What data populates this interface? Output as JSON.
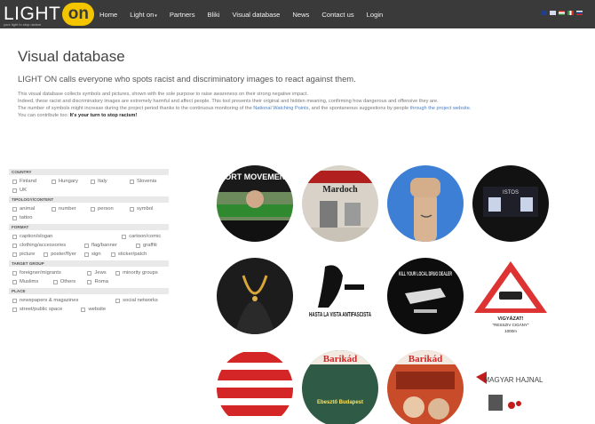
{
  "logo": {
    "word": "LIGHT",
    "on": "on",
    "sub": "your light to stop racism"
  },
  "nav": [
    "Home",
    "Light on",
    "Partners",
    "Bliki",
    "Visual database",
    "News",
    "Contact us",
    "Login"
  ],
  "nav_dropdown_marker": "▾",
  "flags": [
    "#1f3e8f",
    "#d52b1e",
    "#3a8f3a",
    "#cfcfcf",
    "#e8c200"
  ],
  "page": {
    "title": "Visual database",
    "subtitle": "LIGHT ON calls everyone who spots racist and discriminatory images to react against them.",
    "desc1": "This visual database collects symbols and pictures, shown with the sole purpose to raise awareness on their strong negative impact.",
    "desc2": "Indeed, these racist and discriminatory images are extremely harmful and affect people. This tool presents their original and hidden meaning, confirming how dangerous and offensive they are.",
    "desc3a": "The number of symbols might increase during the project period thanks to the continuous monitoring of the ",
    "desc3_link1": "National Watching Points",
    "desc3b": ", and the spontaneous suggestions by people ",
    "desc3_link2": "through the project website",
    "desc3c": ".",
    "desc4a": "You can contribute too: ",
    "desc4_strong": "It's your turn to stop racism!"
  },
  "filters": {
    "country": {
      "label": "Country",
      "options": [
        "Finland",
        "Hungary",
        "Italy",
        "Slovenia",
        "UK"
      ]
    },
    "typology": {
      "label": "Tipology/content",
      "options": [
        "animal",
        "number",
        "person",
        "symbol",
        "tattoo"
      ]
    },
    "format": {
      "label": "Format",
      "options": [
        "caption/slogan",
        "cartoon/comic",
        "clothing/accessories",
        "flag/banner",
        "graffiti",
        "picture",
        "poster/flyer",
        "sign",
        "sticker/patch"
      ]
    },
    "target": {
      "label": "Target group",
      "options": [
        "foreigner/migrants",
        "Jews",
        "minority groups",
        "Muslims",
        "Others",
        "Roma"
      ]
    },
    "place": {
      "label": "Place",
      "options": [
        "newspapers & magazines",
        "social networks",
        "street/public space",
        "website"
      ]
    }
  },
  "gallery": {
    "t1": "PORT MOVEMENT",
    "t2": "Mardoch",
    "t3": "ISTOS",
    "t4": "HASTA LA VISTA ANTIFASCISTA",
    "t5": "KILL YOUR LOCAL DRUG DEALER",
    "t6": "VIGYÁZAT!",
    "t6b": "\"RESSZIV CIGÁNY\"",
    "t6c": "1000m",
    "t7": "Barikád",
    "t7b": "Ebesztő Budapest",
    "t8": "Barikád",
    "t9": "MAGYAR HAJNAL"
  }
}
